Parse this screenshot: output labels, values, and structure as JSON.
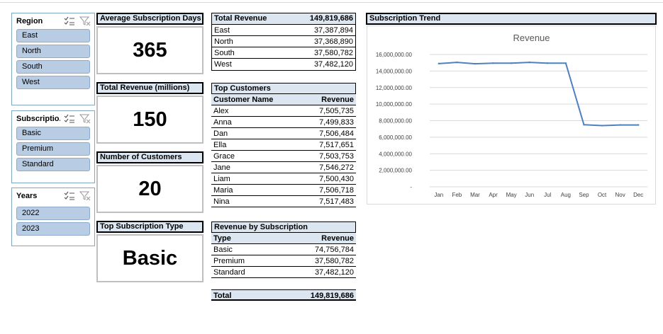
{
  "slicers": {
    "region": {
      "title": "Region",
      "items": [
        "East",
        "North",
        "South",
        "West"
      ]
    },
    "subscription": {
      "title": "Subscriptio...",
      "items": [
        "Basic",
        "Premium",
        "Standard"
      ]
    },
    "years": {
      "title": "Years",
      "items": [
        "2022",
        "2023"
      ]
    }
  },
  "kpis": {
    "avg_days": {
      "title": "Average Subscription Days",
      "value": "365"
    },
    "total_revenue_m": {
      "title": "Total Revenue (millions)",
      "value": "150"
    },
    "customers": {
      "title": "Number of Customers",
      "value": "20"
    },
    "top_type": {
      "title": "Top Subscription Type",
      "value": "Basic"
    }
  },
  "total_revenue_table": {
    "header_label": "Total Revenue",
    "header_value": "149,819,686",
    "rows": [
      {
        "label": "East",
        "value": "37,387,894"
      },
      {
        "label": "North",
        "value": "37,368,890"
      },
      {
        "label": "South",
        "value": "37,580,782"
      },
      {
        "label": "West",
        "value": "37,482,120"
      }
    ]
  },
  "top_customers_table": {
    "title": "Top Customers",
    "col_name": "Customer Name",
    "col_value": "Revenue",
    "rows": [
      {
        "label": "Alex",
        "value": "7,505,735"
      },
      {
        "label": "Anna",
        "value": "7,499,833"
      },
      {
        "label": "Dan",
        "value": "7,506,484"
      },
      {
        "label": "Ella",
        "value": "7,517,651"
      },
      {
        "label": "Grace",
        "value": "7,503,753"
      },
      {
        "label": "Jane",
        "value": "7,546,272"
      },
      {
        "label": "Liam",
        "value": "7,500,430"
      },
      {
        "label": "Maria",
        "value": "7,506,718"
      },
      {
        "label": "Nina",
        "value": "7,517,483"
      }
    ]
  },
  "revenue_by_sub_table": {
    "title": "Revenue by Subscription",
    "col_name": "Type",
    "col_value": "Revenue",
    "rows": [
      {
        "label": "Basic",
        "value": "74,756,784"
      },
      {
        "label": "Premium",
        "value": "37,580,782"
      },
      {
        "label": "Standard",
        "value": "37,482,120"
      }
    ],
    "total_label": "Total",
    "total_value": "149,819,686"
  },
  "chart_section_title": "Subscription Trend",
  "chart_data": {
    "type": "line",
    "title": "Revenue",
    "categories": [
      "Jan",
      "Feb",
      "Mar",
      "Apr",
      "May",
      "Jun",
      "Jul",
      "Aug",
      "Sep",
      "Oct",
      "Nov",
      "Dec"
    ],
    "values": [
      14900000,
      15050000,
      14880000,
      14950000,
      14950000,
      15050000,
      14950000,
      14950000,
      7500000,
      7400000,
      7480000,
      7480000
    ],
    "ylim": [
      0,
      16000000
    ],
    "ytick_values": [
      0,
      2000000,
      4000000,
      6000000,
      8000000,
      10000000,
      12000000,
      14000000,
      16000000
    ],
    "ytick_labels": [
      "-",
      "2,000,000.00",
      "4,000,000.00",
      "6,000,000.00",
      "8,000,000.00",
      "10,000,000.00",
      "12,000,000.00",
      "14,000,000.00",
      "16,000,000.00"
    ],
    "grid": true,
    "line_color": "#4f81bd"
  }
}
